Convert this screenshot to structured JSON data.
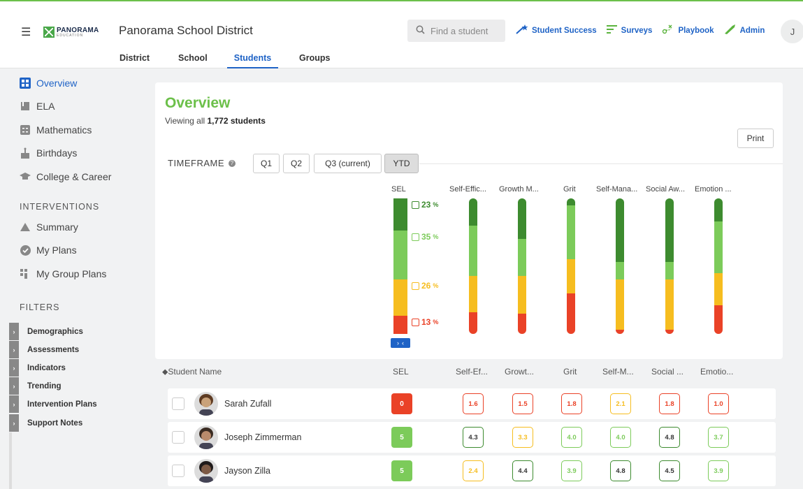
{
  "header": {
    "logo_name": "PANORAMA",
    "logo_sub": "EDUCATION",
    "district_name": "Panorama School District",
    "search_placeholder": "Find a student",
    "nav": [
      {
        "label": "Student Success",
        "icon": "magic-wand-icon"
      },
      {
        "label": "Surveys",
        "icon": "bars-icon"
      },
      {
        "label": "Playbook",
        "icon": "playbook-icon"
      },
      {
        "label": "Admin",
        "icon": "admin-icon"
      }
    ],
    "user_initial": "J",
    "tabs": [
      "District",
      "School",
      "Students",
      "Groups"
    ],
    "active_tab": "Students"
  },
  "sidebar": {
    "items": [
      {
        "label": "Overview",
        "icon": "overview-icon",
        "active": true
      },
      {
        "label": "ELA",
        "icon": "book-icon"
      },
      {
        "label": "Mathematics",
        "icon": "calculator-icon"
      },
      {
        "label": "Birthdays",
        "icon": "cake-icon"
      },
      {
        "label": "College & Career",
        "icon": "graduation-cap-icon"
      }
    ],
    "interventions_heading": "INTERVENTIONS",
    "intervention_items": [
      {
        "label": "Summary",
        "icon": "triangle-icon"
      },
      {
        "label": "My Plans",
        "icon": "check-circle-icon"
      },
      {
        "label": "My Group Plans",
        "icon": "group-plans-icon"
      }
    ],
    "filters_heading": "FILTERS",
    "filters": [
      "Demographics",
      "Assessments",
      "Indicators",
      "Trending",
      "Intervention Plans",
      "Support Notes"
    ]
  },
  "overview": {
    "title": "Overview",
    "viewing_prefix": "Viewing all",
    "viewing_count": "1,772 students",
    "print_label": "Print",
    "timeframe_label": "TIMEFRAME",
    "timeframes": [
      "Q1",
      "Q2",
      "Q3 (current)",
      "YTD"
    ],
    "selected_timeframe": "YTD"
  },
  "colors": {
    "dark_green": "#3d8b2f",
    "light_green": "#7ccb5a",
    "yellow": "#f6bd1f",
    "red": "#ea4227",
    "accent_blue": "#1f63c6",
    "brand_green": "#6cc04a"
  },
  "chart_data": {
    "type": "bar",
    "categories": [
      "SEL",
      "Self-Effic...",
      "Growth M...",
      "Grit",
      "Self-Mana...",
      "Social Aw...",
      "Emotion ..."
    ],
    "series": [
      {
        "name": "dark green",
        "values": [
          23,
          20,
          30,
          5,
          47,
          47,
          17
        ]
      },
      {
        "name": "light green",
        "values": [
          35,
          37,
          27,
          40,
          13,
          13,
          38
        ]
      },
      {
        "name": "yellow",
        "values": [
          26,
          27,
          28,
          25,
          37,
          37,
          24
        ]
      },
      {
        "name": "red",
        "values": [
          13,
          16,
          15,
          30,
          3,
          3,
          21
        ]
      }
    ],
    "sel_percent_labels": [
      "23",
      "35",
      "26",
      "13"
    ]
  },
  "table": {
    "sort_icon": "sort-icon",
    "headers": [
      "Student Name",
      "SEL",
      "Self-Ef...",
      "Growt...",
      "Grit",
      "Self-M...",
      "Social ...",
      "Emotio..."
    ],
    "rows": [
      {
        "name": "Sarah Zufall",
        "sel": "0",
        "sel_color": "red",
        "scores": [
          [
            "1.6",
            "red"
          ],
          [
            "1.5",
            "red"
          ],
          [
            "1.8",
            "red"
          ],
          [
            "2.1",
            "yellow"
          ],
          [
            "1.8",
            "red"
          ],
          [
            "1.0",
            "red"
          ]
        ]
      },
      {
        "name": "Joseph Zimmerman",
        "sel": "5",
        "sel_color": "green",
        "scores": [
          [
            "4.3",
            "darkgreen"
          ],
          [
            "3.3",
            "yellow"
          ],
          [
            "4.0",
            "green"
          ],
          [
            "4.0",
            "green"
          ],
          [
            "4.8",
            "darkgreen"
          ],
          [
            "3.7",
            "green"
          ]
        ]
      },
      {
        "name": "Jayson Zilla",
        "sel": "5",
        "sel_color": "green",
        "scores": [
          [
            "2.4",
            "yellow"
          ],
          [
            "4.4",
            "darkgreen"
          ],
          [
            "3.9",
            "green"
          ],
          [
            "4.8",
            "darkgreen"
          ],
          [
            "4.5",
            "darkgreen"
          ],
          [
            "3.9",
            "green"
          ]
        ]
      }
    ]
  }
}
